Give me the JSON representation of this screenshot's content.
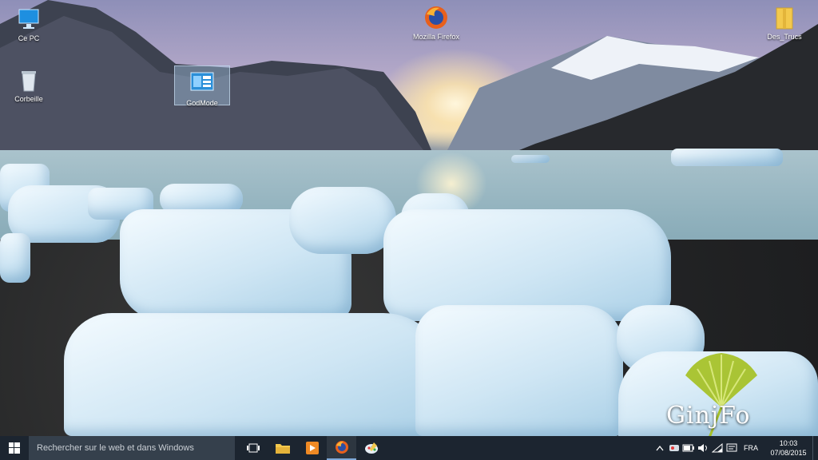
{
  "desktop": {
    "icons": [
      {
        "label": "Ce PC",
        "icon": "computer-icon"
      },
      {
        "label": "Corbeille",
        "icon": "recycle-bin-icon"
      },
      {
        "label": "GodMode",
        "icon": "control-panel-icon"
      },
      {
        "label": "Mozilla Firefox",
        "icon": "firefox-icon"
      },
      {
        "label": "Des_Trucs",
        "icon": "folder-icon"
      }
    ],
    "watermark": "GinjFo"
  },
  "taskbar": {
    "search_placeholder": "Rechercher sur le web et dans Windows",
    "pinned": [
      {
        "name": "task-view",
        "icon": "task-view-icon"
      },
      {
        "name": "file-explorer",
        "icon": "folder-icon"
      },
      {
        "name": "media-player",
        "icon": "media-player-icon"
      },
      {
        "name": "firefox",
        "icon": "firefox-icon"
      },
      {
        "name": "paint",
        "icon": "paint-icon"
      }
    ],
    "tray": {
      "language": "FRA",
      "time": "10:03",
      "date": "07/08/2015"
    }
  },
  "colors": {
    "taskbar_bg": "#1c2530",
    "search_bg": "#35404c",
    "accent": "#7fa9d8"
  }
}
